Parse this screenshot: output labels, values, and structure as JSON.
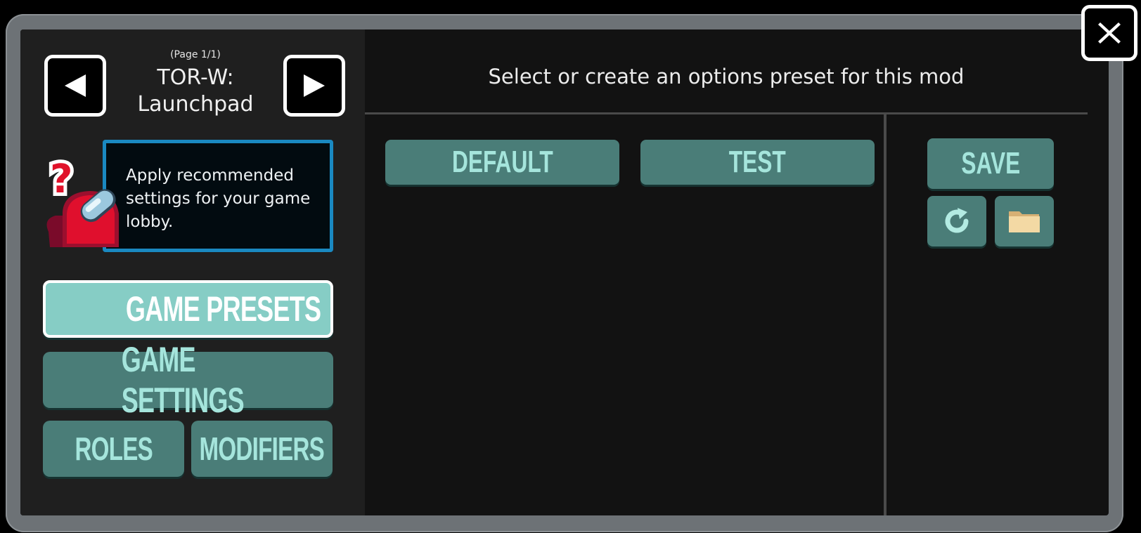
{
  "nav": {
    "page_indicator": "(Page 1/1)",
    "mod_title_line1": "TOR-W:",
    "mod_title_line2": "Launchpad",
    "prev_icon": "left-triangle-icon",
    "next_icon": "right-triangle-icon"
  },
  "help": {
    "text": "Apply recommended settings for your game lobby.",
    "icon": "crewmate-question-icon"
  },
  "menu": {
    "game_presets": "GAME PRESETS",
    "game_settings": "GAME SETTINGS",
    "roles": "ROLES",
    "modifiers": "MODIFIERS"
  },
  "main": {
    "header": "Select or create an options preset for this mod",
    "presets": [
      "DEFAULT",
      "TEST"
    ]
  },
  "actions": {
    "save": "SAVE",
    "reload_icon": "reload-icon",
    "folder_icon": "folder-icon"
  },
  "close_icon": "close-x-icon",
  "colors": {
    "button_teal": "#4a7d78",
    "button_text": "#a5e5dc",
    "active_button": "#86cdc5",
    "help_border": "#1a89c1"
  }
}
